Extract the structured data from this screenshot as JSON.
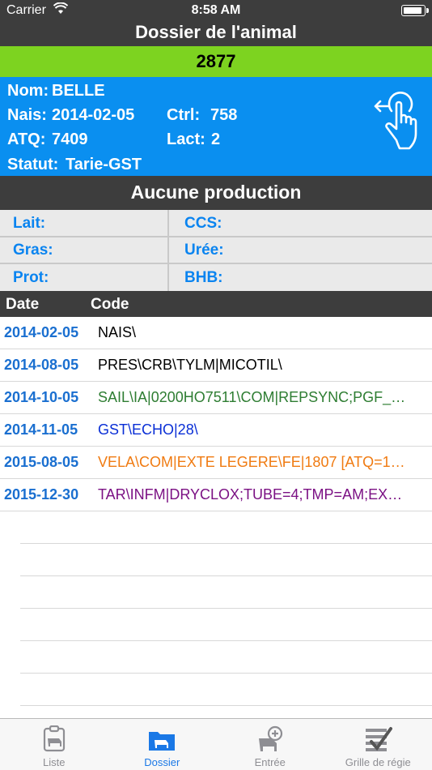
{
  "status_bar": {
    "carrier": "Carrier",
    "time": "8:58 AM"
  },
  "nav": {
    "title": "Dossier de l'animal"
  },
  "animal": {
    "id": "2877",
    "nom_label": "Nom:",
    "nom": "BELLE",
    "nais_label": "Nais:",
    "nais": "2014-02-05",
    "ctrl_label": "Ctrl:",
    "ctrl": "758",
    "atq_label": "ATQ:",
    "atq": "7409",
    "lact_label": "Lact:",
    "lact": "2",
    "statut_label": "Statut:",
    "statut": "Tarie-GST"
  },
  "production": {
    "title": "Aucune production",
    "fields": [
      "Lait:",
      "CCS:",
      "Gras:",
      "Urée:",
      "Prot:",
      "BHB:"
    ]
  },
  "table": {
    "headers": [
      "Date",
      "Code"
    ],
    "rows": [
      {
        "date": "2014-02-05",
        "code": "NAIS\\",
        "color": "#000000"
      },
      {
        "date": "2014-08-05",
        "code": "PRES\\CRB\\TYLM|MICOTIL\\",
        "color": "#000000"
      },
      {
        "date": "2014-10-05",
        "code": "SAIL\\IA|0200HO7511\\COM|REPSYNC;PGF_…",
        "color": "#2e7d32"
      },
      {
        "date": "2014-11-05",
        "code": "GST\\ECHO|28\\",
        "color": "#0a2fd6"
      },
      {
        "date": "2015-08-05",
        "code": "VELA\\COM|EXTE LEGERE\\FE|1807 [ATQ=1…",
        "color": "#f07b12"
      },
      {
        "date": "2015-12-30",
        "code": "TAR\\INFM|DRYCLOX;TUBE=4;TMP=AM;EX…",
        "color": "#7b1184"
      }
    ]
  },
  "tabs": [
    {
      "label": "Liste",
      "icon": "list-cow-icon"
    },
    {
      "label": "Dossier",
      "icon": "folder-cow-icon"
    },
    {
      "label": "Entrée",
      "icon": "add-cow-icon"
    },
    {
      "label": "Grille de régie",
      "icon": "checklist-icon"
    }
  ],
  "colors": {
    "header_dark": "#3d3d3d",
    "id_green": "#7dd320",
    "animal_blue": "#0a8ff0",
    "tab_active": "#1a78e6"
  }
}
